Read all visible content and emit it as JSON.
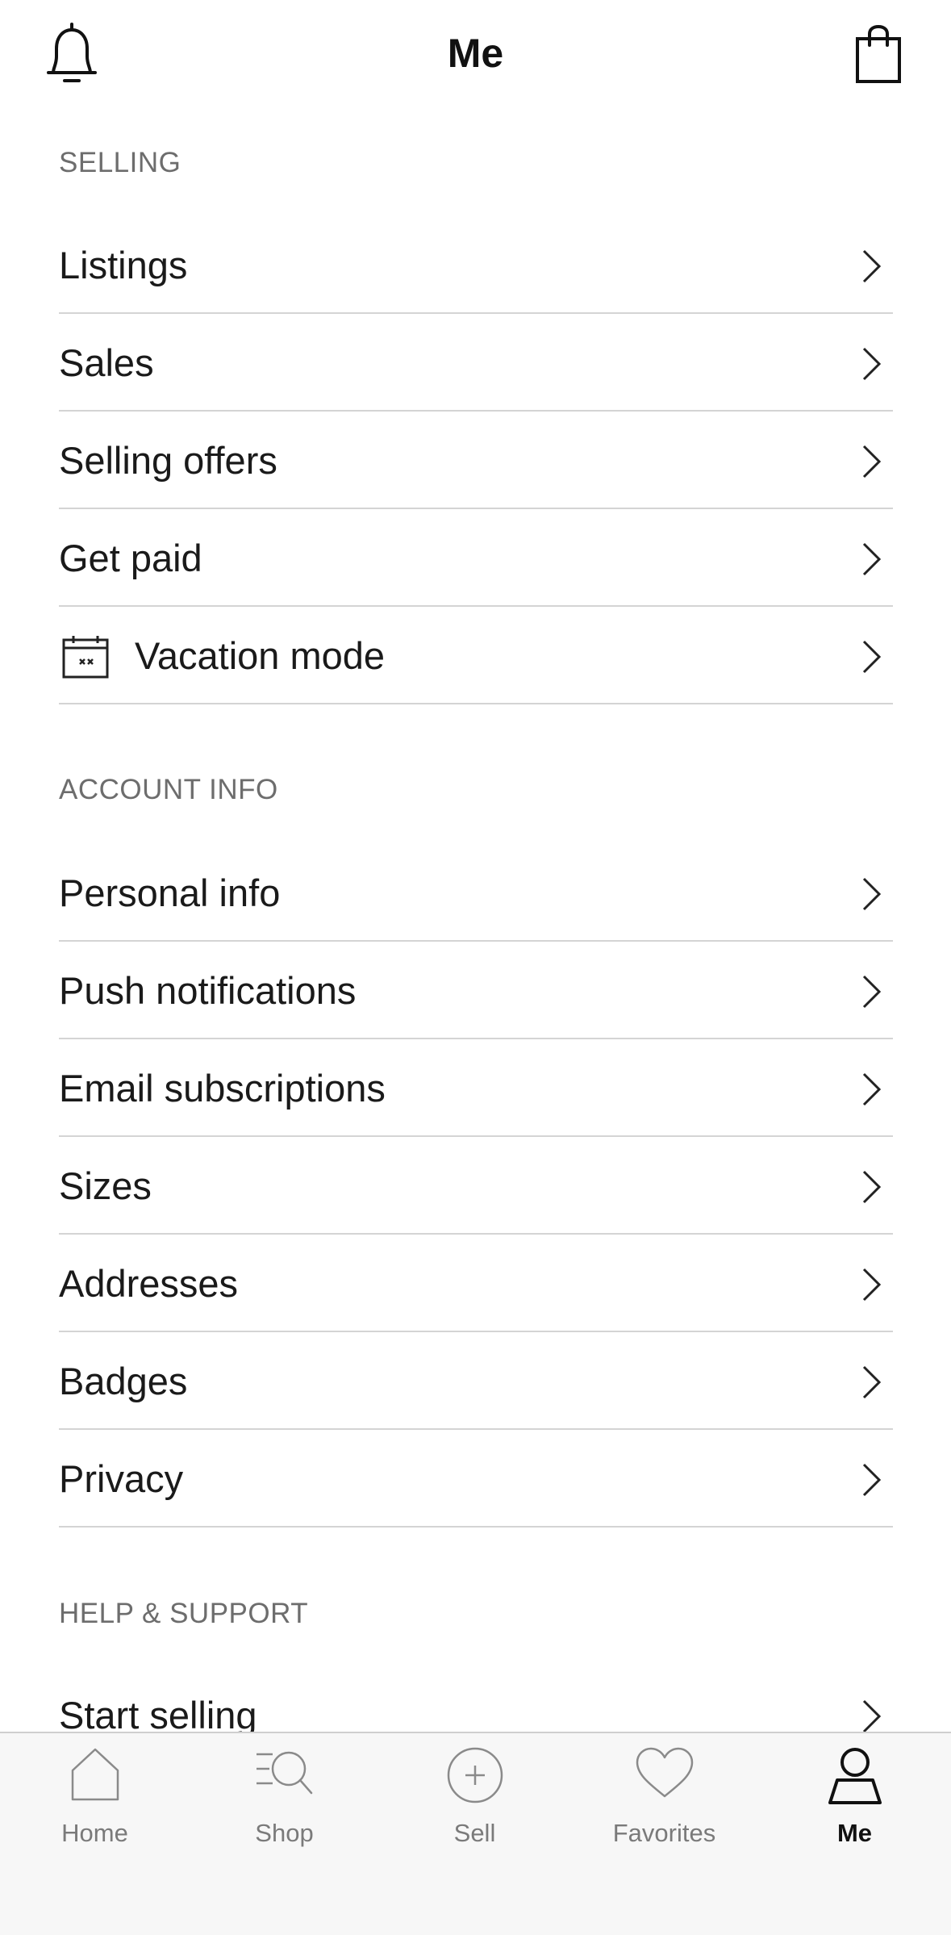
{
  "header": {
    "title": "Me",
    "left_icon": "bell-icon",
    "right_icon": "shopping-bag-icon"
  },
  "sections": {
    "selling": {
      "title": "SELLING",
      "items": [
        {
          "label": "Listings"
        },
        {
          "label": "Sales"
        },
        {
          "label": "Selling offers"
        },
        {
          "label": "Get paid"
        },
        {
          "label": "Vacation mode",
          "icon": "calendar-icon"
        }
      ]
    },
    "account": {
      "title": "ACCOUNT INFO",
      "items": [
        {
          "label": "Personal info"
        },
        {
          "label": "Push notifications"
        },
        {
          "label": "Email subscriptions"
        },
        {
          "label": "Sizes"
        },
        {
          "label": "Addresses"
        },
        {
          "label": "Badges"
        },
        {
          "label": "Privacy"
        }
      ]
    },
    "help": {
      "title": "HELP & SUPPORT",
      "items": [
        {
          "label": "Start selling"
        }
      ]
    }
  },
  "tabbar": {
    "items": [
      {
        "label": "Home",
        "icon": "home-icon"
      },
      {
        "label": "Shop",
        "icon": "search-list-icon"
      },
      {
        "label": "Sell",
        "icon": "plus-circle-icon"
      },
      {
        "label": "Favorites",
        "icon": "heart-icon"
      },
      {
        "label": "Me",
        "icon": "person-icon",
        "active": true
      }
    ]
  },
  "colors": {
    "text": "#1a1a1a",
    "section_title": "#6d6d6d",
    "divider": "#d4d4d4",
    "tabbar_bg": "#f7f7f7",
    "tab_inactive": "#7a7a7a",
    "tab_active": "#111111"
  }
}
